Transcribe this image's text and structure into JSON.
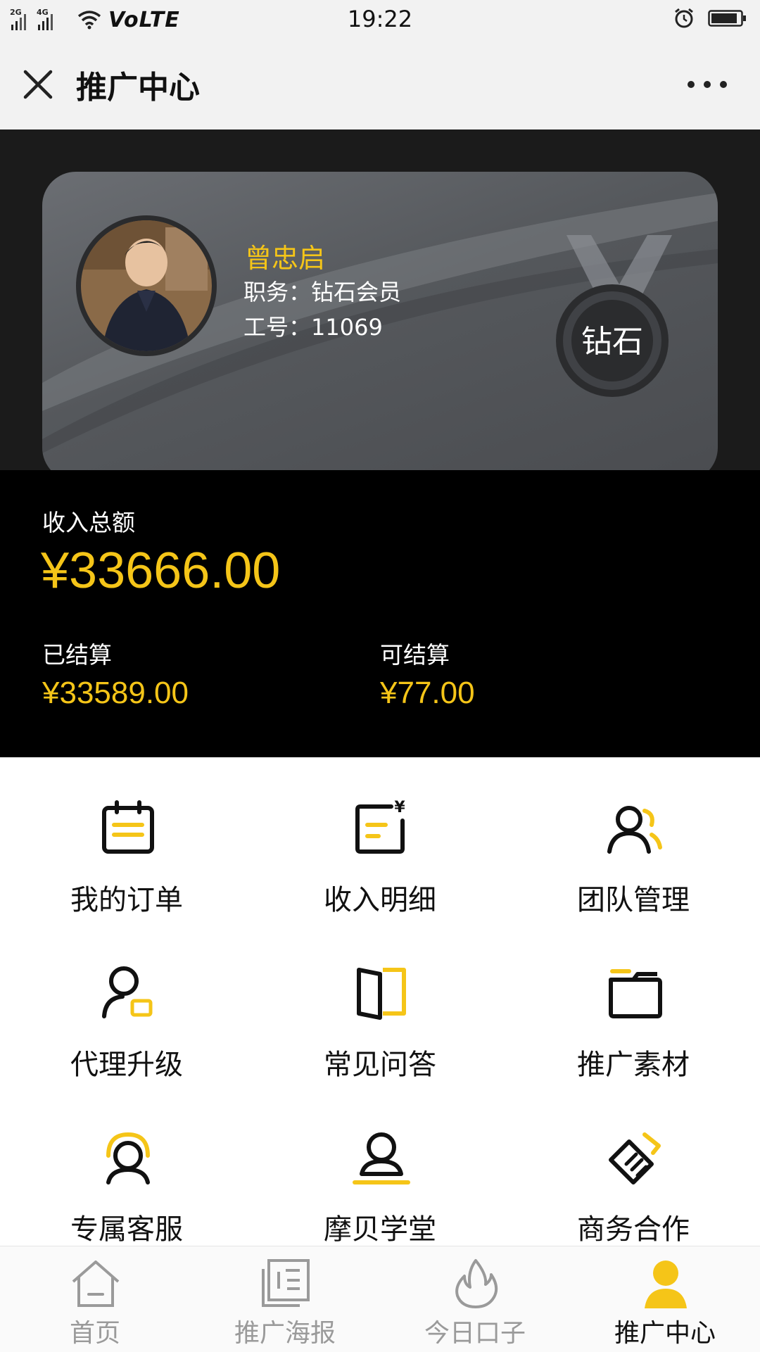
{
  "status_bar": {
    "network": "2G 4G",
    "volte": "VoLTE",
    "time": "19:22"
  },
  "header": {
    "title": "推广中心"
  },
  "profile": {
    "name": "曾忠启",
    "role": "职务：钻石会员",
    "employee_id": "工号：11069",
    "badge": "钻石"
  },
  "income": {
    "total_label": "收入总额",
    "total_value": "¥33666.00",
    "settled_label": "已结算",
    "settled_value": "¥33589.00",
    "available_label": "可结算",
    "available_value": "¥77.00"
  },
  "menu": [
    {
      "label": "我的订单",
      "icon": "calendar-icon"
    },
    {
      "label": "收入明细",
      "icon": "income-detail-icon"
    },
    {
      "label": "团队管理",
      "icon": "team-icon"
    },
    {
      "label": "代理升级",
      "icon": "agent-upgrade-icon"
    },
    {
      "label": "常见问答",
      "icon": "faq-book-icon"
    },
    {
      "label": "推广素材",
      "icon": "folder-icon"
    },
    {
      "label": "专属客服",
      "icon": "customer-service-icon"
    },
    {
      "label": "摩贝学堂",
      "icon": "academy-icon"
    },
    {
      "label": "商务合作",
      "icon": "cooperation-icon"
    }
  ],
  "bottom_nav": [
    {
      "label": "首页",
      "icon": "home-icon",
      "active": false
    },
    {
      "label": "推广海报",
      "icon": "poster-icon",
      "active": false
    },
    {
      "label": "今日口子",
      "icon": "flame-icon",
      "active": false
    },
    {
      "label": "推广中心",
      "icon": "user-center-icon",
      "active": true
    }
  ],
  "colors": {
    "accent": "#f5c518",
    "dark_bg": "#1b1b1b",
    "panel_bg": "#000000",
    "inactive_nav": "#9a9a9a"
  }
}
